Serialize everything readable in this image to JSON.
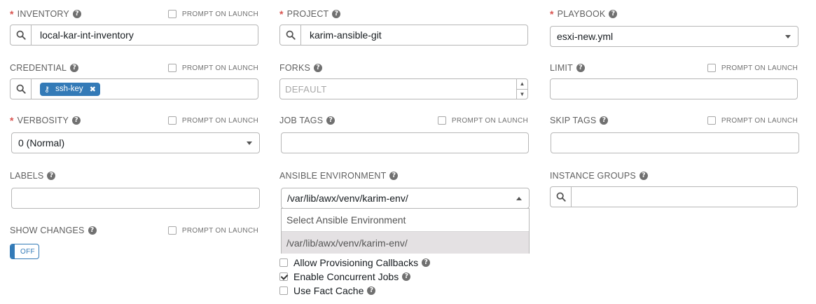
{
  "inventory": {
    "label": "INVENTORY",
    "value": "local-kar-int-inventory",
    "prompt": "PROMPT ON LAUNCH"
  },
  "project": {
    "label": "PROJECT",
    "value": "karim-ansible-git"
  },
  "playbook": {
    "label": "PLAYBOOK",
    "value": "esxi-new.yml"
  },
  "credential": {
    "label": "CREDENTIAL",
    "chip": "ssh-key",
    "prompt": "PROMPT ON LAUNCH"
  },
  "forks": {
    "label": "FORKS",
    "placeholder": "DEFAULT"
  },
  "limit": {
    "label": "LIMIT",
    "value": "",
    "prompt": "PROMPT ON LAUNCH"
  },
  "verbosity": {
    "label": "VERBOSITY",
    "value": "0 (Normal)",
    "prompt": "PROMPT ON LAUNCH"
  },
  "job_tags": {
    "label": "JOB TAGS",
    "value": "",
    "prompt": "PROMPT ON LAUNCH"
  },
  "skip_tags": {
    "label": "SKIP TAGS",
    "value": "",
    "prompt": "PROMPT ON LAUNCH"
  },
  "labels": {
    "label": "LABELS"
  },
  "ansible_env": {
    "label": "ANSIBLE ENVIRONMENT",
    "value": "/var/lib/awx/venv/karim-env/",
    "options": [
      "Select Ansible Environment",
      "/var/lib/awx/venv/karim-env/"
    ]
  },
  "instance_groups": {
    "label": "INSTANCE GROUPS"
  },
  "show_changes": {
    "label": "SHOW CHANGES",
    "toggle": "OFF",
    "prompt": "PROMPT ON LAUNCH"
  },
  "options": {
    "provisioning": {
      "label": "Allow Provisioning Callbacks",
      "checked": false
    },
    "concurrent": {
      "label": "Enable Concurrent Jobs",
      "checked": true
    },
    "fact_cache": {
      "label": "Use Fact Cache",
      "checked": false
    }
  },
  "colors": {
    "accent": "#337ab7",
    "required": "#d9534f"
  }
}
